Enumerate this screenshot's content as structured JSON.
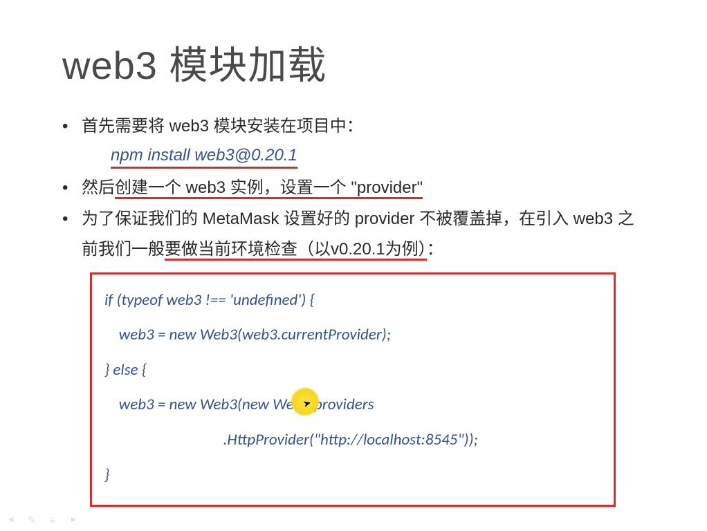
{
  "title": "web3 模块加载",
  "bullets": {
    "b1": "首先需要将 web3 模块安装在项目中：",
    "install_cmd": "npm install web3@0.20.1",
    "b2_part1": "然后",
    "b2_underlined": "创建一个 web3 实例，设置一个 \"provider\"",
    "b3_part1": "为了保证我们的 MetaMask 设置好的 provider 不被覆盖掉，在引入 web3 之前我们一般",
    "b3_underlined": "要做当前环境检查（以v0.20.1为例）",
    "b3_part3": "："
  },
  "code": {
    "l1": "if (typeof web3 !== 'undefined') {",
    "l2": "    web3 = new Web3(web3.currentProvider);",
    "l3": "} else {",
    "l4": "    web3 = new Web3(new Web3.providers",
    "l5": "                                 .HttpProvider(\"http://localhost:8545\"));",
    "l6": "}"
  },
  "footer": {
    "prev": "⯇",
    "pen": "✎",
    "menu": "≡",
    "next": "⯈"
  }
}
